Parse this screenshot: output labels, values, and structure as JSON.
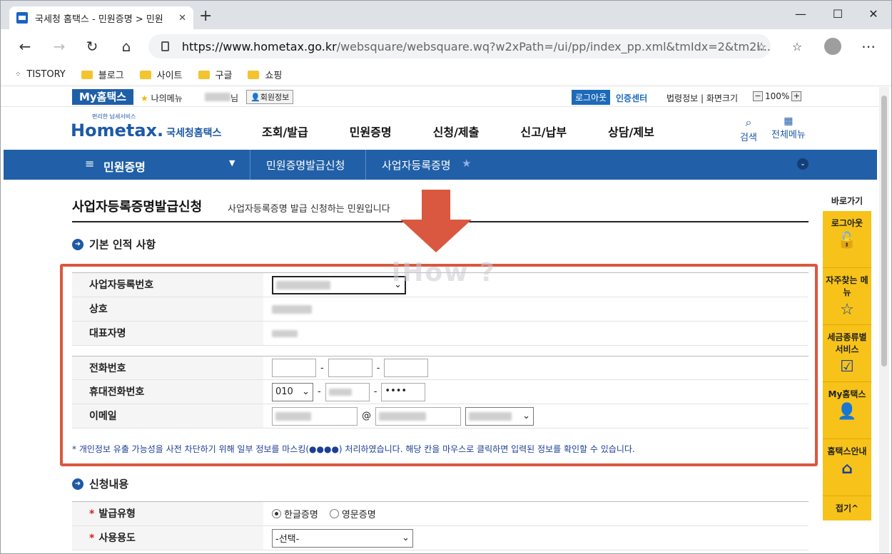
{
  "browser": {
    "tab_title": "국세청 홈택스 - 민원증명 > 민원",
    "url_domain": "https://www.hometax.go.kr",
    "url_rest": "/websquare/websquare.wq?w2xPath=/ui/pp/index_pp.xml&tmIdx=2&tm2l...",
    "bookmarks": [
      "TISTORY",
      "블로그",
      "사이트",
      "구글",
      "쇼핑"
    ]
  },
  "topstrip": {
    "my_hometax": "My홈택스",
    "my_menu": "나의메뉴",
    "name_suffix": "님",
    "member_info": "회원정보",
    "logout": "로그아웃",
    "cert_center": "인증센터",
    "law_info": "법령정보",
    "screen_size": "화면크기",
    "zoom": "100%"
  },
  "header": {
    "logo": "Hometax.",
    "logo_ko": "국세청홈택스",
    "logo_tag": "편리한 납세서비스",
    "nav": [
      "조회/발급",
      "민원증명",
      "신청/제출",
      "신고/납부",
      "상담/제보"
    ],
    "search": "검색",
    "all_menu": "전체메뉴"
  },
  "breadcrumb": {
    "main": "민원증명",
    "crumb1": "민원증명발급신청",
    "crumb2": "사업자등록증명"
  },
  "page": {
    "title": "사업자등록증명발급신청",
    "desc": "사업자등록증명 발급 신청하는 민원입니다",
    "section1": "기본 인적 사항",
    "section2": "신청내용",
    "note": "* 개인정보 유출 가능성을 사전 차단하기 위해 일부 정보를 마스킹(●●●●) 처리하였습니다. 해당 칸을 마우스로 클릭하면 입력된 정보를 확인할 수 있습니다.",
    "watermark": "iHow ?"
  },
  "form1": {
    "biz_no_label": "사업자등록번호",
    "trade_name_label": "상호",
    "rep_label": "대표자명",
    "phone_label": "전화번호",
    "mobile_label": "휴대전화번호",
    "mobile_prefix": "010",
    "mobile_last": "••••",
    "email_label": "이메일",
    "email_at": "@"
  },
  "form2": {
    "issue_type_label": "발급유형",
    "issue_ko": "한글증명",
    "issue_en": "영문증명",
    "usage_label": "사용용도",
    "usage_placeholder": "-선택-"
  },
  "quickbar": {
    "header": "바로가기",
    "items": [
      "로그아웃",
      "자주찾는 메뉴",
      "세금종류별 서비스",
      "My홈택스",
      "홈택스안내"
    ],
    "fold": "접기^"
  }
}
